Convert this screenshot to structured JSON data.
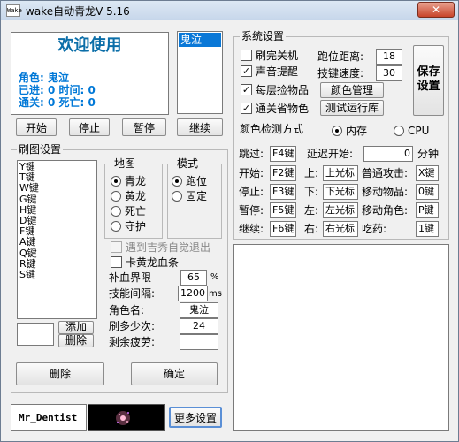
{
  "window": {
    "icon_text": "Wake",
    "title": "wake自动青龙V 5.16",
    "close_label": "✕"
  },
  "welcome": {
    "heading": "欢迎使用",
    "line1": "角色: 鬼泣",
    "line2": "已进: 0  时间: 0",
    "line3": "通关: 0  死亡: 0"
  },
  "role_list": {
    "selected": "鬼泣"
  },
  "control_buttons": {
    "start": "开始",
    "stop": "停止",
    "pause": "暂停",
    "continue": "继续"
  },
  "map_settings": {
    "title": "刷图设置",
    "keys": [
      "Y键",
      "T键",
      "W键",
      "G键",
      "H键",
      "D键",
      "F键",
      "A键",
      "Q键",
      "R键",
      "S键"
    ],
    "add_label": "添加",
    "delete_small_label": "删除",
    "map_group": {
      "title": "地图",
      "options": [
        "青龙",
        "黄龙",
        "死亡",
        "守护"
      ],
      "selected": "青龙"
    },
    "mode_group": {
      "title": "模式",
      "options": [
        "跑位",
        "固定"
      ],
      "selected": "跑位"
    },
    "chk_jixiu": "遇到吉秀自觉退出",
    "chk_kahuang": "卡黄龙血条",
    "blood_limit_label": "补血界限",
    "blood_limit_value": "65",
    "blood_limit_unit": "%",
    "skill_interval_label": "技能间隔:",
    "skill_interval_value": "1200",
    "skill_interval_unit": "ms",
    "role_name_label": "角色名:",
    "role_name_value": "鬼泣",
    "brush_times_label": "刷多少次:",
    "brush_times_value": "24",
    "fatigue_label": "剩余疲劳:",
    "fatigue_value": "",
    "delete_label": "删除",
    "confirm_label": "确定"
  },
  "footer": {
    "author": "Mr_Dentist",
    "more_settings": "更多设置"
  },
  "system_settings": {
    "title": "系统设置",
    "chk_shutdown": "刷完关机",
    "chk_sound": "声音提醒",
    "chk_pickup": "每层捡物品",
    "chk_save_items": "通关省物色",
    "run_distance_label": "跑位距离:",
    "run_distance_value": "18",
    "skill_speed_label": "技键速度:",
    "skill_speed_value": "30",
    "save_label": "保存设置",
    "color_manage": "颜色管理",
    "test_run": "测试运行库",
    "detect_label": "颜色检测方式",
    "detect_memory": "内存",
    "detect_cpu": "CPU",
    "detect_selected": "内存",
    "jump_label": "跳过:",
    "jump_value": "F4键",
    "delay_label": "延迟开始:",
    "delay_value": "0",
    "delay_unit": "分钟",
    "start_label": "开始:",
    "start_value": "F2键",
    "up_label": "上:",
    "up_value": "上光标",
    "normal_attack_label": "普通攻击:",
    "normal_attack_value": "X键",
    "stop_label": "停止:",
    "stop_value": "F3键",
    "down_label": "下:",
    "down_value": "下光标",
    "move_item_label": "移动物品:",
    "move_item_value": "0键",
    "pause_label": "暂停:",
    "pause_value": "F5键",
    "left_label": "左:",
    "left_value": "左光标",
    "move_role_label": "移动角色:",
    "move_role_value": "P键",
    "continue_label": "继续:",
    "continue_value": "F6键",
    "right_label": "右:",
    "right_value": "右光标",
    "eat_label": "吃药:",
    "eat_value": "1键"
  },
  "colors": {
    "accent_blue": "#0078d7",
    "welcome_blue": "#0b6ea8",
    "selection": "#0a78d7"
  }
}
